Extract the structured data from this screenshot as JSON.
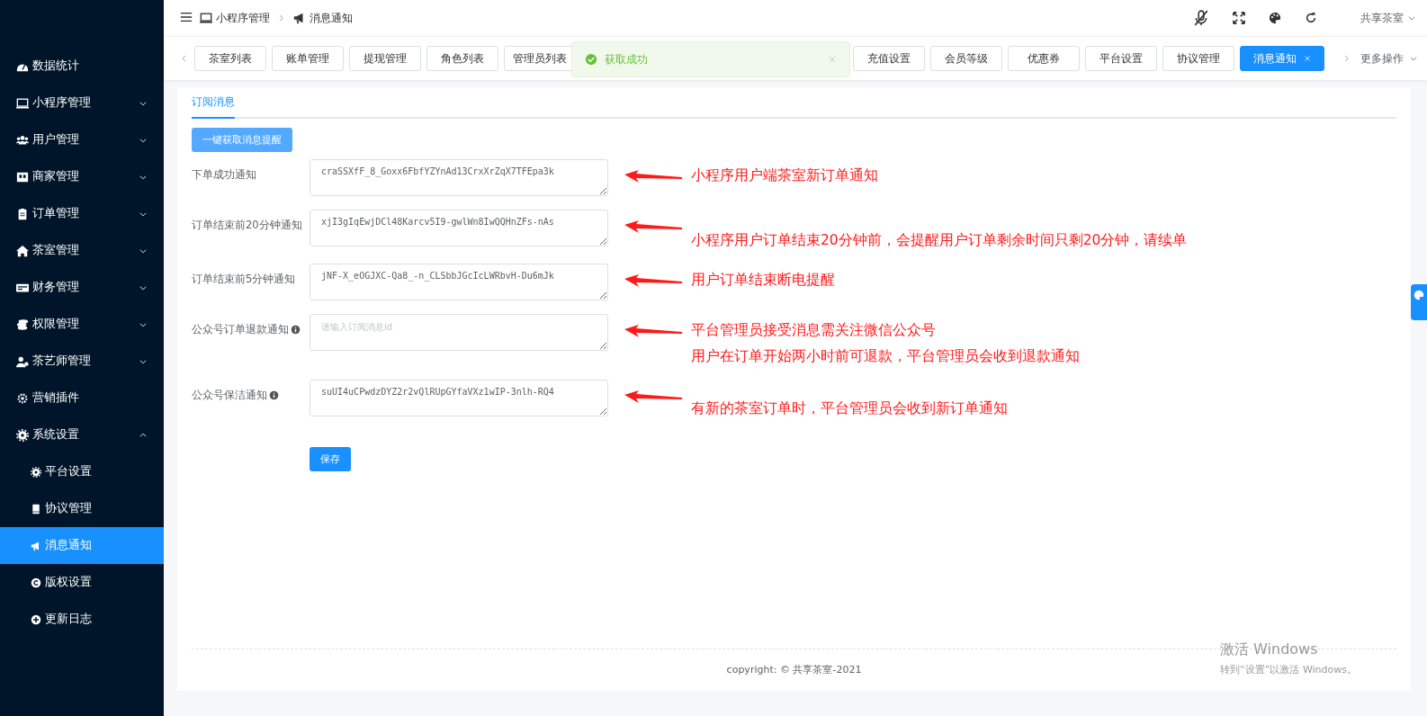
{
  "sidebar": {
    "items": [
      {
        "label": "数据统计",
        "has_children": false
      },
      {
        "label": "小程序管理",
        "expanded": false,
        "has_children": true
      },
      {
        "label": "用户管理",
        "expanded": false,
        "has_children": true
      },
      {
        "label": "商家管理",
        "expanded": false,
        "has_children": true
      },
      {
        "label": "订单管理",
        "expanded": false,
        "has_children": true
      },
      {
        "label": "茶室管理",
        "expanded": false,
        "has_children": true
      },
      {
        "label": "财务管理",
        "expanded": false,
        "has_children": true
      },
      {
        "label": "权限管理",
        "expanded": false,
        "has_children": true
      },
      {
        "label": "茶艺师管理",
        "expanded": false,
        "has_children": true
      },
      {
        "label": "营销插件",
        "has_children": false
      },
      {
        "label": "系统设置",
        "expanded": true,
        "has_children": true,
        "children": [
          {
            "label": "平台设置",
            "selected": false
          },
          {
            "label": "协议管理",
            "selected": false
          },
          {
            "label": "消息通知",
            "selected": true
          },
          {
            "label": "版权设置",
            "selected": false
          },
          {
            "label": "更新日志",
            "selected": false
          }
        ]
      }
    ]
  },
  "header": {
    "breadcrumb": [
      "小程序管理",
      "消息通知"
    ],
    "user": "共享茶室"
  },
  "tags": {
    "left": [
      {
        "label": "茶室列表",
        "selected": false
      },
      {
        "label": "账单管理",
        "selected": false
      },
      {
        "label": "提现管理",
        "selected": false
      },
      {
        "label": "角色列表",
        "selected": false
      },
      {
        "label": "管理员列表",
        "selected": false
      }
    ],
    "right": [
      {
        "label": "充值设置",
        "selected": false
      },
      {
        "label": "会员等级",
        "selected": false
      },
      {
        "label": "优惠券",
        "selected": false
      },
      {
        "label": "平台设置",
        "selected": false
      },
      {
        "label": "协议管理",
        "selected": false
      },
      {
        "label": "消息通知",
        "selected": true
      }
    ],
    "more": "更多操作"
  },
  "toast": {
    "message": "获取成功"
  },
  "content": {
    "tabs": [
      {
        "label": "订阅消息",
        "selected": true
      }
    ],
    "fetch_button": "一键获取消息提醒",
    "fields": [
      {
        "label": "下单成功通知",
        "info": false,
        "value": "craSSXfF_8_Goxx6FbfYZYnAd13CrxXrZqX7TFEpa3k",
        "annotations": [
          "小程序用户端茶室新订单通知"
        ]
      },
      {
        "label": "订单结束前20分钟通知",
        "info": false,
        "value": "xjI3gIqEwjDCl48Karcv5I9-gwlWn8IwQQHnZFs-nAs",
        "annotations": [
          "小程序用户订单结束20分钟前，会提醒用户订单剩余时间只剩20分钟，请续单"
        ]
      },
      {
        "label": "订单结束前5分钟通知",
        "info": false,
        "value": "jNF-X_eOGJXC-Qa8_-n_CLSbbJGcIcLWRbvH-Du6mJk",
        "annotations": [
          "用户订单结束断电提醒"
        ]
      },
      {
        "label": "公众号订单退款通知",
        "info": true,
        "placeholder": "请输入订阅消息id",
        "annotations": [
          "平台管理员接受消息需关注微信公众号",
          "用户在订单开始两小时前可退款，平台管理员会收到退款通知"
        ]
      },
      {
        "label": "公众号保洁通知",
        "info": true,
        "value": "suUI4uCPwdzDYZ2r2vQlRUpGYfaVXz1wIP-3nlh-RQ4",
        "annotations": [
          "有新的茶室订单时，平台管理员会收到新订单通知"
        ]
      }
    ],
    "save_button": "保存"
  },
  "footer": {
    "copyright": "copyright: © 共享茶室-2021"
  },
  "os_watermark": [
    "激活 Windows",
    "转到“设置”以激活 Windows。"
  ]
}
